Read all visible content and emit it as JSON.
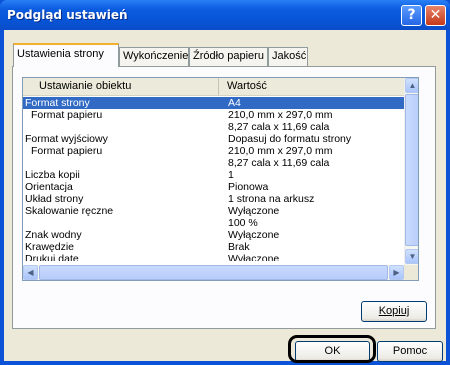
{
  "window": {
    "title": "Podgląd ustawień"
  },
  "titlebar_buttons": {
    "help": "?",
    "close": "✕"
  },
  "tabs": [
    {
      "label": "Ustawienia strony"
    },
    {
      "label": "Wykończenie"
    },
    {
      "label": "Źródło papieru"
    },
    {
      "label": "Jakość"
    }
  ],
  "list": {
    "columns": {
      "key": "Ustawianie obiektu",
      "value": "Wartość"
    },
    "rows": [
      {
        "key": "Format strony",
        "value": "A4",
        "selected": true
      },
      {
        "key": "Format papieru",
        "value": "210,0 mm x 297,0 mm"
      },
      {
        "key": "",
        "value": "8,27 cala x 11,69 cala"
      },
      {
        "key": "Format wyjściowy",
        "value": "Dopasuj do formatu strony"
      },
      {
        "key": "Format papieru",
        "value": "210,0 mm x 297,0 mm"
      },
      {
        "key": "",
        "value": "8,27 cala x 11,69 cala"
      },
      {
        "key": "Liczba kopii",
        "value": "1"
      },
      {
        "key": "Orientacja",
        "value": "Pionowa"
      },
      {
        "key": "Układ strony",
        "value": "1 strona na arkusz"
      },
      {
        "key": "Skalowanie ręczne",
        "value": "Wyłączone"
      },
      {
        "key": "",
        "value": "100 %"
      },
      {
        "key": "Znak wodny",
        "value": "Wyłączone"
      },
      {
        "key": "Krawędzie",
        "value": "Brak"
      },
      {
        "key": "Drukuj datę",
        "value": "Wyłączone"
      }
    ]
  },
  "scroll_glyphs": {
    "up": "▲",
    "down": "▼",
    "left": "◀",
    "right": "▶"
  },
  "buttons": {
    "copy": "Kopiuj",
    "ok": "OK",
    "help": "Pomoc"
  }
}
